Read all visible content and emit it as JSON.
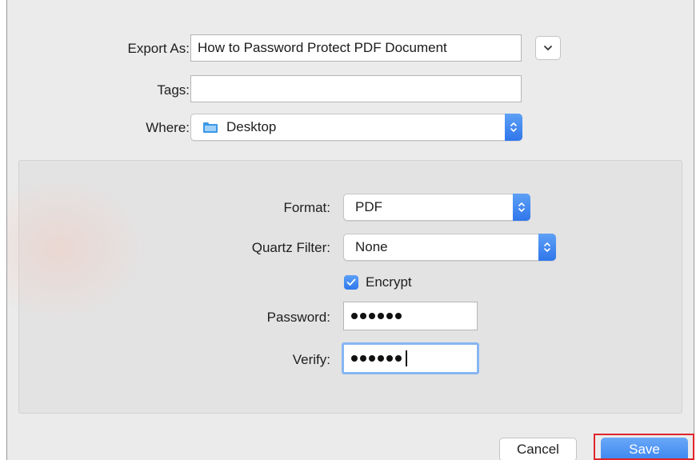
{
  "export_as": {
    "label": "Export As:",
    "value": "How to Password Protect PDF Document"
  },
  "tags": {
    "label": "Tags:",
    "value": ""
  },
  "where": {
    "label": "Where:",
    "value": "Desktop",
    "icon": "folder-icon"
  },
  "format": {
    "label": "Format:",
    "value": "PDF"
  },
  "quartz_filter": {
    "label": "Quartz Filter:",
    "value": "None"
  },
  "encrypt": {
    "label": "Encrypt",
    "checked": true
  },
  "password": {
    "label": "Password:",
    "dot_count": 6
  },
  "verify": {
    "label": "Verify:",
    "dot_count": 6
  },
  "buttons": {
    "cancel": "Cancel",
    "save": "Save"
  },
  "colors": {
    "accent": "#2f78ec",
    "highlight_border": "#e0242b",
    "folder": "#3b98e6"
  }
}
